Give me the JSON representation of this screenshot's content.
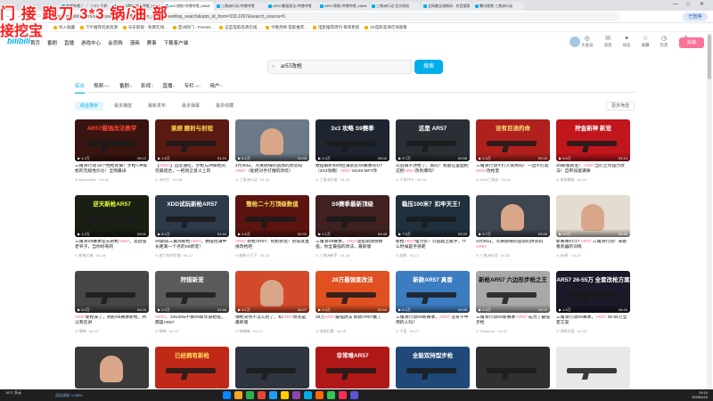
{
  "overlay": {
    "line1": "门 接 跑刀 3*3 锅/油  部",
    "line2": "接挖宝"
  },
  "browser": {
    "tabs": [
      "哔哩哔哩 (゜-゜)つロ 干杯~",
      "AR57改枪-哔哩哔哩_bilibili",
      "ar57改枪-哔哩哔哩_bilibili",
      "三角洲行动-哔哩哔哩",
      "AR57最强改法-哔哩哔哩",
      "AR57改装-哔哩哔哩_bilibili",
      "三角洲行动 官方网站",
      "全网最全改枪码 - 抖音搜索",
      "腾讯视频 三角洲行动"
    ],
    "window_controls": [
      "—",
      "□",
      "✕"
    ],
    "url": "search.bilibili.com/all?keyword=ar57改枪&from_source=webtop_search&spm_id_from=333.1007&search_source=5",
    "profile": "已暂停",
    "bookmarks": [
      "导入收藏",
      "下午推荐优质资源",
      "乐乐影视 - 免费在线...",
      "亚洲热门 - Free4K...",
      "这些电影高清在线...",
      "今晚热映 电影推荐...",
      "电影推荐周刊 每周更新",
      "2K电影高清在线观看"
    ]
  },
  "site": {
    "logo": "bilibili",
    "nav": [
      "首页",
      "番剧",
      "直播",
      "游戏中心",
      "会员购",
      "漫画",
      "赛事",
      "下载客户端"
    ],
    "right": [
      {
        "label": "大会员",
        "icon": "vip-icon"
      },
      {
        "label": "消息",
        "icon": "message-icon"
      },
      {
        "label": "动态",
        "icon": "dynamic-icon"
      },
      {
        "label": "收藏",
        "icon": "favorite-icon"
      },
      {
        "label": "历史",
        "icon": "history-icon"
      },
      {
        "label": "创作中心",
        "icon": "creator-icon"
      }
    ],
    "upload": "投稿",
    "brand_color": "#00aeec",
    "pink": "#fb7299"
  },
  "search": {
    "value": "ar57改枪",
    "button": "搜索"
  },
  "categories": [
    {
      "label": "综合",
      "count": ""
    },
    {
      "label": "视频",
      "count": "99+"
    },
    {
      "label": "番剧",
      "count": "0"
    },
    {
      "label": "影视",
      "count": "0"
    },
    {
      "label": "直播",
      "count": "0"
    },
    {
      "label": "专栏",
      "count": "99+"
    },
    {
      "label": "用户",
      "count": "0"
    }
  ],
  "sorts": [
    "综合排序",
    "最多播放",
    "最新发布",
    "最多弹幕",
    "最多收藏"
  ],
  "more_filters": "更多筛选",
  "videos": [
    {
      "cap": "AR57最强改法教学",
      "bg": "#3a1410",
      "cc": "#ff4433",
      "views": "4.2万",
      "dur": "05:12",
      "title": "三角洲行动 四个档枪式摘！步枪+冲锋枪的无敌性价比！全网最详",
      "author": "AlmondNei · 04-18"
    },
    {
      "cap": "兼顾 腰射与射程",
      "bg": "#5a1a12",
      "cc": "#ffd24a",
      "views": "1.8万",
      "dur": "01:24",
      "title": "【AR57】远近通吃，步枪与冲锋枪的完美结合，一把真正意义上的",
      "author": "洲大行 · 04-08"
    },
    {
      "cap": "",
      "bg": "#6b7a86",
      "cc": "#fff",
      "face": true,
      "views": "6.1万",
      "dur": "03:45",
      "title": "4月30日，杰莱丽嗨挤战场的改装码AR57（能把对手打懵的改装）",
      "author": "三角洲行动 · 04-30"
    },
    {
      "cap": "3x3 攻略 S9赛季",
      "bg": "#1e2530",
      "cc": "#fff",
      "views": "2.4万",
      "dur": "06:02",
      "title": "数值解析和你拉满武装S9赛季的1/7（3X3攻略）AR57 M249 MP7改",
      "author": "三角洲大佬 · 04-25"
    },
    {
      "cap": "这是 AR57",
      "bg": "#2a2f36",
      "cc": "#fff",
      "views": "9.7万",
      "dur": "00:58",
      "title": "以后再不改枪了，真的！我能在里面把这把AR57改到爆吗？",
      "author": "千面FPS · 04-19"
    },
    {
      "cap": "没有巨浪的命",
      "bg": "#b0201c",
      "cc": "#ffe97a",
      "views": "3.3万",
      "dur": "02:15",
      "title": "三角洲行动不打人够用吗！一边不打就AR57改枪套",
      "author": "Deer三角洲 · 04-21"
    },
    {
      "cap": "狩金新神 新宠",
      "bg": "#c0161c",
      "cc": "#fff",
      "views": "5.5万",
      "dur": "04:10",
      "title": "S9新版新宠！ AR57当打之年强力改法！自带加速满弹",
      "author": "老张聊枪 · 04-22"
    },
    {
      "cap": "逆天新枪AR57",
      "bg": "#1a1f14",
      "cc": "#e8ff3a",
      "views": "1.2万",
      "dur": "03:01",
      "title": "三角洲S9赛季逆天新枪AR57，高启强老爷子，当你好奇的",
      "author": "枪械大佬 · 04-16"
    },
    {
      "cap": "XDD试玩新枪AR57",
      "bg": "#2d3a4a",
      "cc": "#ffffff",
      "views": "8.4万",
      "dur": "01:44",
      "title": "S9期间三角洲新枪AR57，数值拉满中长距离一个点的S9新宠！",
      "author": "老六的杂货铺 · 04-17"
    },
    {
      "cap": "整枪二十万顶级数值",
      "bg": "#5c1410",
      "cc": "#ffe25a",
      "views": "2.6万",
      "dur": "02:33",
      "title": "AR57 新枪AR57：机枪新宠！别等就直接改枪吧",
      "author": "刚枪小王子 · 04-15"
    },
    {
      "cap": "S9赛季最新顶级",
      "bg": "#402020",
      "cc": "#fff",
      "views": "1.1万",
      "dur": "04:48",
      "title": "三角洲S9赛季，AR57混乱刚激情数值，你全最强的改法，最新版",
      "author": "三角洲新手 · 04-18"
    },
    {
      "cap": "稳压100米？扣牢天王！",
      "bg": "#20303c",
      "cc": "#fff",
      "views": "7.9万",
      "dur": "02:20",
      "title": "新枪AR57强力装！可超越之敌手，什么时候是手感呢",
      "author": "刚枪 · 04-17"
    },
    {
      "cap": "",
      "bg": "#3e4650",
      "cc": "#fff",
      "face": true,
      "views": "3.7万",
      "dur": "02:06",
      "title": "4月30日，杰莱丽嗨挤战场的改装码AR57",
      "author": "三角洲行动 · 04-30"
    },
    {
      "cap": "",
      "bg": "#e4dcd0",
      "cc": "#333",
      "face": true,
      "views": "4.0万",
      "dur": "00:40",
      "title": "新赛季KC17 AR57 三角洲行动！来看看武器的训练",
      "author": "BB鱼 · 04-12"
    },
    {
      "cap": "",
      "bg": "#464646",
      "cc": "#fff",
      "views": "6.3万",
      "dur": "03:18",
      "title": "AR57新枪来了，两把S9赛季新枪，所以我在讲",
      "author": "嗨嗨 · 04-14"
    },
    {
      "cap": "狩猎新宠",
      "bg": "#5a5a5a",
      "cc": "#fff",
      "views": "2.2万",
      "dur": "01:56",
      "title": "AR57、10w40w不换S9新年限枪组，都是AR57",
      "author": "嗨嗨 · 04-14"
    },
    {
      "cap": "",
      "bg": "#d24a2a",
      "cc": "#fff",
      "face": true,
      "views": "9.1万",
      "dur": "05:27",
      "title": "弹枪突然不怎么奶了，和AR57改装是最新版",
      "author": "嗨嗨嗨 · 04-17"
    },
    {
      "cap": "28万最强套改法",
      "bg": "#e05020",
      "cc": "#fff",
      "views": "1.9万",
      "dur": "02:44",
      "title": "28万AR57最强改法 新款AR57赢了",
      "author": "改枪狂魔 · 04-15"
    },
    {
      "cap": "新款AR57 真香",
      "bg": "#3c7cc0",
      "cc": "#fff",
      "views": "5.2万",
      "dur": "03:39",
      "title": "三角洲行动S9新赛季，AR57 还有不中用的人吗！",
      "author": "千面 · 04-17"
    },
    {
      "cap": "新枪AR57 六边形步枪之王",
      "bg": "#a8a8a8",
      "cc": "#111",
      "views": "2.8万",
      "dur": "04:02",
      "title": "三角洲行动S9新赛季 AR57 成为了最强步枪",
      "author": "Tobuoma · 04-18"
    },
    {
      "cap": "AR57 26-55万 全套改枪方案",
      "bg": "#1a1a2a",
      "cc": "#fff",
      "views": "1.5万",
      "dur": "06:20",
      "title": "三角洲行动S9赛季，AR57 26-55万全套方案",
      "author": "改枪方案 · 04-16"
    },
    {
      "cap": "",
      "bg": "#3a3a3a",
      "cc": "#fff",
      "face": true,
      "views": "",
      "dur": "",
      "title": "",
      "author": ""
    },
    {
      "cap": "已经拥有新枪",
      "bg": "#c02818",
      "cc": "#ffe05a",
      "views": "",
      "dur": "",
      "title": "",
      "author": ""
    },
    {
      "cap": "",
      "bg": "#2f3540",
      "cc": "#fff",
      "views": "",
      "dur": "",
      "title": "",
      "author": ""
    },
    {
      "cap": "非常难AR57",
      "bg": "#b01818",
      "cc": "#fff",
      "views": "",
      "dur": "",
      "title": "",
      "author": ""
    },
    {
      "cap": "全能双持型步枪",
      "bg": "#204878",
      "cc": "#fff",
      "views": "",
      "dur": "",
      "title": "",
      "author": ""
    },
    {
      "cap": "",
      "bg": "#303030",
      "cc": "#fff",
      "views": "",
      "dur": "",
      "title": "",
      "author": ""
    },
    {
      "cap": "",
      "bg": "#e8e8e8",
      "cc": "#333",
      "views": "",
      "dur": "",
      "title": "",
      "author": ""
    }
  ],
  "taskbar": {
    "weather": "16°C 多云",
    "ticker": "深证成指 +0.88%",
    "time": "19:10",
    "date": "2025/4/22"
  },
  "taskbar_icon_colors": [
    "#0a84ff",
    "#f5a623",
    "#2bb24c",
    "#e8453c",
    "#1da1f2",
    "#ffcf00",
    "#8e44ad",
    "#00aeec",
    "#ff6a00",
    "#34c759",
    "#ff2d55",
    "#5856d6"
  ]
}
